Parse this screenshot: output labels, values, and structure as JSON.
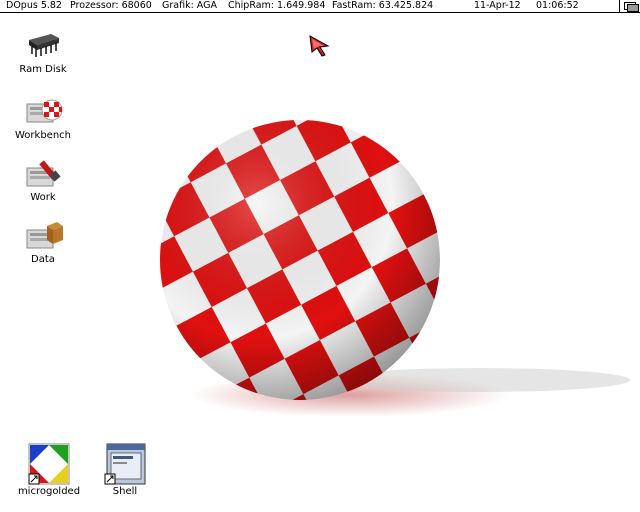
{
  "screen_title": {
    "dopus": "DOpus 5.82",
    "processor": "Prozessor: 68060",
    "graphics": "Grafik: AGA",
    "chipram": "ChipRam: 1.649.984",
    "fastram": "FastRam: 63.425.824",
    "date": "11-Apr-12",
    "time": "01:06:52"
  },
  "desktop_icons": [
    {
      "label": "Ram Disk",
      "icon": "ram-chip-icon"
    },
    {
      "label": "Workbench",
      "icon": "workbench-disk-icon"
    },
    {
      "label": "Work",
      "icon": "work-disk-icon"
    },
    {
      "label": "Data",
      "icon": "data-disk-icon"
    },
    {
      "label": "microgolded",
      "icon": "microgolded-app-icon"
    },
    {
      "label": "Shell",
      "icon": "shell-app-icon"
    }
  ],
  "colors": {
    "ball_red": "#e01010",
    "ball_white": "#f4f4f4",
    "pointer": "#d02020"
  }
}
